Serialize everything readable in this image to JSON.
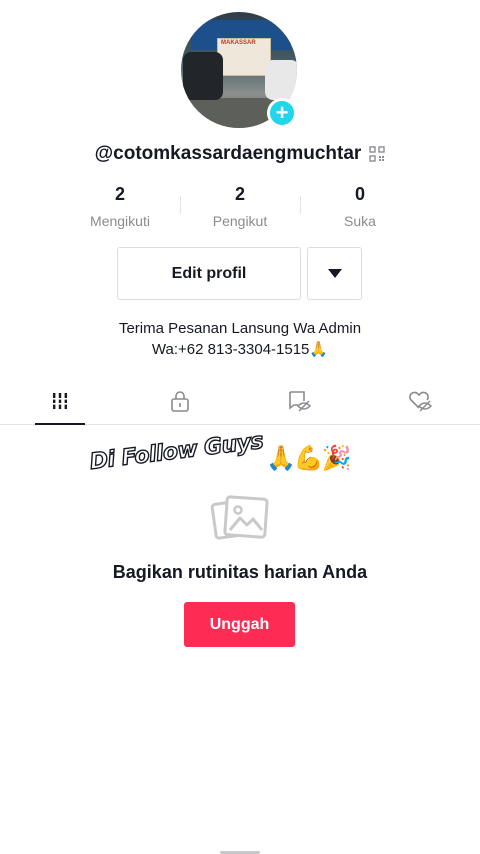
{
  "profile": {
    "username": "@cotomkassardaengmuchtar",
    "avatar_banner_text": "MAKASSAR"
  },
  "stats": [
    {
      "value": "2",
      "label": "Mengikuti"
    },
    {
      "value": "2",
      "label": "Pengikut"
    },
    {
      "value": "0",
      "label": "Suka"
    }
  ],
  "actions": {
    "edit_profile_label": "Edit profil"
  },
  "bio": {
    "line1": "Terima Pesanan Lansung Wa Admin",
    "line2": "Wa:+62 813-3304-1515🙏"
  },
  "tabs": [
    {
      "icon": "grid-icon",
      "active": true
    },
    {
      "icon": "lock-icon",
      "active": false
    },
    {
      "icon": "tagged-hidden-icon",
      "active": false
    },
    {
      "icon": "liked-hidden-icon",
      "active": false
    }
  ],
  "sticker": {
    "text": "Di Follow Guys",
    "emoji": "🙏💪🎉"
  },
  "empty_state": {
    "icon": "image-icon",
    "title": "Bagikan rutinitas harian Anda",
    "button_label": "Unggah"
  },
  "colors": {
    "accent": "#fe2c55",
    "badge": "#20d5ec",
    "text": "#161823",
    "muted": "#8a8b91"
  }
}
